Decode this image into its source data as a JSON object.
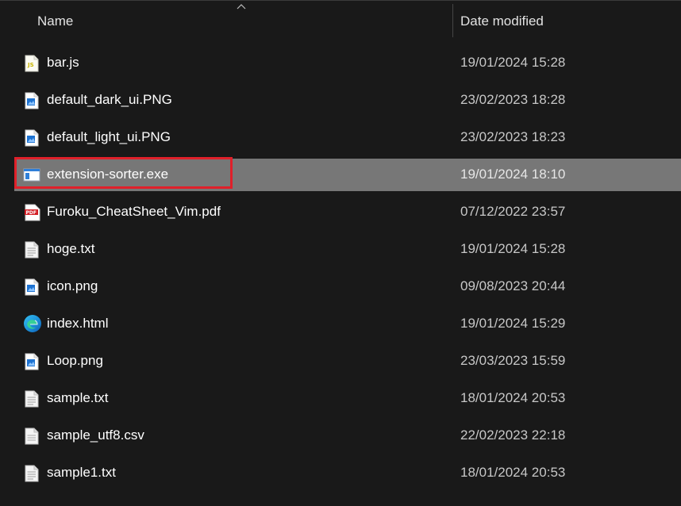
{
  "header": {
    "name_label": "Name",
    "date_label": "Date modified",
    "sort_direction": "ascending"
  },
  "files": [
    {
      "name": "bar.js",
      "date": "19/01/2024 15:28",
      "icon": "js-file-icon",
      "selected": false
    },
    {
      "name": "default_dark_ui.PNG",
      "date": "23/02/2023 18:28",
      "icon": "image-file-icon",
      "selected": false
    },
    {
      "name": "default_light_ui.PNG",
      "date": "23/02/2023 18:23",
      "icon": "image-file-icon",
      "selected": false
    },
    {
      "name": "extension-sorter.exe",
      "date": "19/01/2024 18:10",
      "icon": "exe-file-icon",
      "selected": true
    },
    {
      "name": "Furoku_CheatSheet_Vim.pdf",
      "date": "07/12/2022 23:57",
      "icon": "pdf-file-icon",
      "selected": false
    },
    {
      "name": "hoge.txt",
      "date": "19/01/2024 15:28",
      "icon": "text-file-icon",
      "selected": false
    },
    {
      "name": "icon.png",
      "date": "09/08/2023 20:44",
      "icon": "image-file-icon",
      "selected": false
    },
    {
      "name": "index.html",
      "date": "19/01/2024 15:29",
      "icon": "edge-html-icon",
      "selected": false
    },
    {
      "name": "Loop.png",
      "date": "23/03/2023 15:59",
      "icon": "image-file-icon",
      "selected": false
    },
    {
      "name": "sample.txt",
      "date": "18/01/2024 20:53",
      "icon": "text-file-icon",
      "selected": false
    },
    {
      "name": "sample_utf8.csv",
      "date": "22/02/2023 22:18",
      "icon": "csv-file-icon",
      "selected": false
    },
    {
      "name": "sample1.txt",
      "date": "18/01/2024 20:53",
      "icon": "text-file-icon",
      "selected": false
    }
  ],
  "colors": {
    "background": "#191919",
    "selection": "#777777",
    "highlight_border": "#e0202a"
  }
}
